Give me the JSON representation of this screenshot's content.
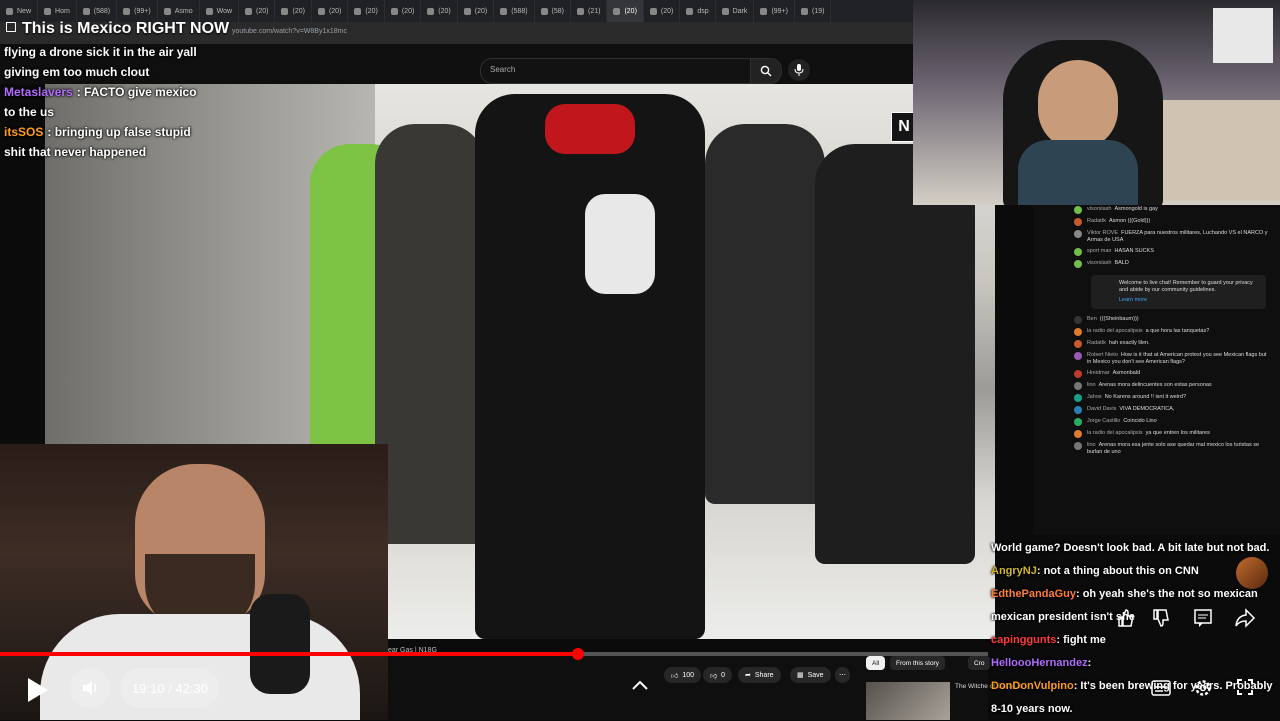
{
  "browser": {
    "tabs": [
      "New",
      "Hom",
      "(588)",
      "(99+)",
      "Asmo",
      "Wow",
      "(20)",
      "(20)",
      "(20)",
      "(20)",
      "(20)",
      "(20)",
      "(20)",
      "(588)",
      "(58)",
      "(21)",
      "(20)",
      "(20)",
      "dsp",
      "Dark",
      "(99+)",
      "(19)"
    ],
    "url": "youtube.com/watch?v=W8By1x18mc"
  },
  "stream": {
    "title": "This is Mexico RIGHT NOW"
  },
  "youtube": {
    "search_placeholder": "Search",
    "news_badge": "N",
    "video_caption": "ear Gas | N18G",
    "like_count": "100",
    "dislike_count": "0",
    "share_label": "Share",
    "save_label": "Save",
    "chips": [
      "All",
      "From this story",
      "Cro"
    ],
    "rec_title": "The Witche of Castle B"
  },
  "chat_overlay_left": [
    {
      "user": "",
      "text": "flying a drone sick it in the air yall",
      "color": "#ffffff"
    },
    {
      "user": "",
      "text": "giving em too much clout",
      "color": "#ffffff"
    },
    {
      "user": "Metaslavers",
      "text": ": FACTO give mexico to the us",
      "color": "#b06cff"
    },
    {
      "user": "itsSOS",
      "text": ": bringing up false stupid shit that never happened",
      "color": "#ff9d1c"
    }
  ],
  "yt_live_chat": {
    "messages_top": [
      {
        "name": "visorslash",
        "text": "Asmongold is gay",
        "color": "#6fbf4a"
      },
      {
        "name": "Radattk",
        "text": "Asmon (((Gold)))",
        "color": "#c75b2c"
      },
      {
        "name": "Viktor ROVE",
        "text": "FUERZA para nuestros militares, Luchando VS el NARCO y Armas de USA",
        "color": "#888888"
      },
      {
        "name": "sport man",
        "text": "HASAN SUCKS",
        "color": "#6fbf4a"
      },
      {
        "name": "visorslash",
        "text": "BALD",
        "color": "#6fbf4a"
      }
    ],
    "welcome_text": "Welcome to live chat! Remember to guard your privacy and abide by our community guidelines.",
    "welcome_link": "Learn more",
    "messages_bottom": [
      {
        "name": "Ben",
        "text": "(((Sheinbaum)))",
        "color": "#333333"
      },
      {
        "name": "la radio del apocalipsis",
        "text": "a que hora las tanquetas?",
        "color": "#e07b2a"
      },
      {
        "name": "Radattk",
        "text": "hah exactly lilen.",
        "color": "#c75b2c"
      },
      {
        "name": "Robert Nieto",
        "text": "How is it that at American protest you see Mexican flags but in Mexico you don't see American flags?",
        "color": "#9b59b6"
      },
      {
        "name": "Hreidmar",
        "text": "Asmonbald",
        "color": "#c0392b"
      },
      {
        "name": "lino",
        "text": "Arenas mora   delincuentes son estas personas",
        "color": "#777777"
      },
      {
        "name": "Jahos",
        "text": "No Karens around !! isnt it weird?",
        "color": "#16a085"
      },
      {
        "name": "David Davis",
        "text": "VIVA DEMOCRATICA,",
        "color": "#2980b9"
      },
      {
        "name": "Jorge Castillo",
        "text": "Coincido Lino",
        "color": "#27ae60"
      },
      {
        "name": "la radio del apocalipsis",
        "text": "ya que entren los militares",
        "color": "#e07b2a"
      },
      {
        "name": "lino",
        "text": "Arenas mora   esa jente solo ase quedar mal mexico los turistas se burlan de uno",
        "color": "#777777"
      }
    ]
  },
  "chat_overlay_right": [
    {
      "user": "",
      "text": "World game? Doesn't look bad. A bit late but not bad.",
      "color": "#ffffff"
    },
    {
      "user": "AngryNJ",
      "text": ": not a thing about this on CNN",
      "color": "#d4b72a"
    },
    {
      "user": "EdthePandaGuy",
      "text": ": oh yeah she's the not so mexican",
      "color": "#ff7d3d"
    },
    {
      "user": "",
      "text": "mexican president isn't she",
      "color": "#ffffff"
    },
    {
      "user": "capinggunts",
      "text": ": fight me",
      "color": "#ff3b3b"
    },
    {
      "user": "HelloooHernandez",
      "text": ":",
      "color": "#b06cff"
    },
    {
      "user": "DonDonVulpino",
      "text": ": It's been brewing for years. Probably",
      "color": "#ff9d1c"
    },
    {
      "user": "",
      "text": "8-10 years now.",
      "color": "#ffffff"
    }
  ],
  "player": {
    "time": "19:10 / 42:30",
    "progress": 0.45
  }
}
